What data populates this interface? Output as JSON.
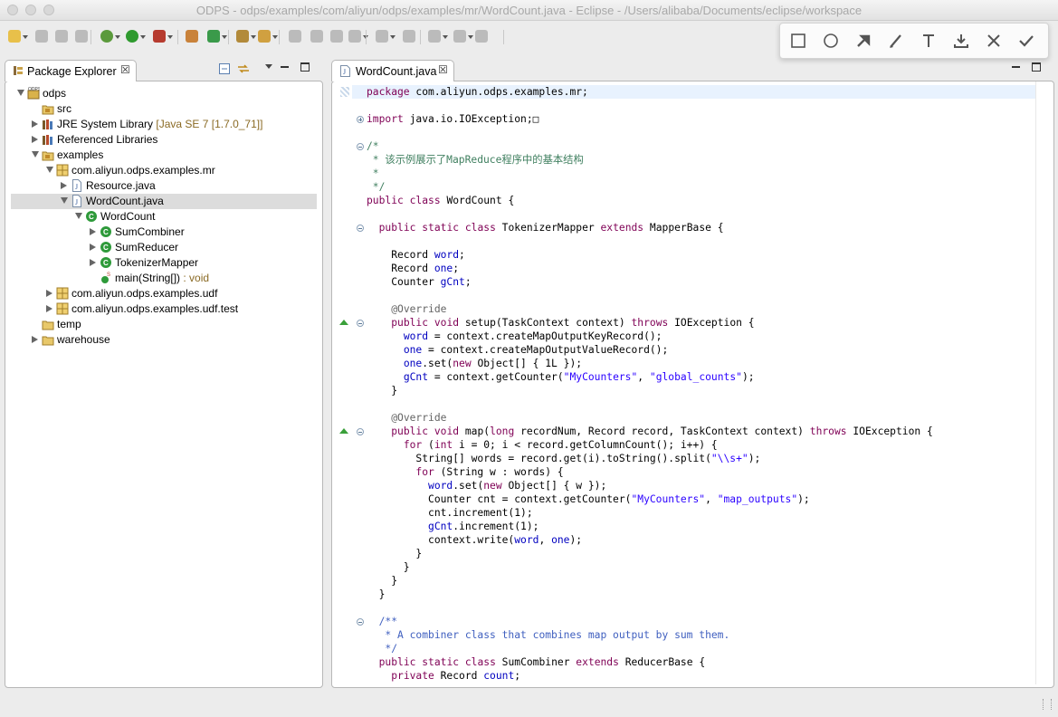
{
  "window": {
    "title": "ODPS - odps/examples/com/aliyun/odps/examples/mr/WordCount.java - Eclipse - /Users/alibaba/Documents/eclipse/workspace"
  },
  "toolbar": {
    "buttons": [
      "new-icon",
      "save-icon",
      "save-all-icon",
      "print-icon",
      "debug-icon",
      "run-icon",
      "run-external-icon",
      "new-java-package-icon",
      "new-java-class-icon",
      "open-type-icon",
      "search-icon",
      "toggle-mark-icon",
      "annotation-icon",
      "breadcrumb-icon",
      "block-icon",
      "next-annotation-icon",
      "prev-annotation-icon",
      "back-icon",
      "forward-icon",
      "pin-editor-icon"
    ]
  },
  "annotation_tools": [
    "rectangle-icon",
    "ellipse-icon",
    "arrow-icon",
    "pen-icon",
    "text-icon",
    "download-icon",
    "close-icon",
    "done-icon"
  ],
  "package_explorer": {
    "tab_label": "Package Explorer",
    "close_glyph": "☒",
    "tree": [
      {
        "label": "odps",
        "icon": "project-icon",
        "level": 0,
        "twisty": "open"
      },
      {
        "label": "src",
        "icon": "source-folder-icon",
        "level": 1,
        "twisty": "none"
      },
      {
        "label": "JRE System Library",
        "decoration": "[Java SE 7 [1.7.0_71]]",
        "icon": "library-icon",
        "level": 1,
        "twisty": "closed"
      },
      {
        "label": "Referenced Libraries",
        "icon": "library-icon",
        "level": 1,
        "twisty": "closed"
      },
      {
        "label": "examples",
        "icon": "source-folder-icon",
        "level": 1,
        "twisty": "open"
      },
      {
        "label": "com.aliyun.odps.examples.mr",
        "icon": "package-icon",
        "level": 2,
        "twisty": "open"
      },
      {
        "label": "Resource.java",
        "icon": "java-file-icon",
        "level": 3,
        "twisty": "closed"
      },
      {
        "label": "WordCount.java",
        "icon": "java-file-icon",
        "level": 3,
        "twisty": "open",
        "selected": true
      },
      {
        "label": "WordCount",
        "icon": "class-icon",
        "level": 4,
        "twisty": "open"
      },
      {
        "label": "SumCombiner",
        "icon": "class-icon",
        "level": 5,
        "twisty": "closed"
      },
      {
        "label": "SumReducer",
        "icon": "class-icon",
        "level": 5,
        "twisty": "closed"
      },
      {
        "label": "TokenizerMapper",
        "icon": "class-icon",
        "level": 5,
        "twisty": "closed"
      },
      {
        "label": "main(String[])",
        "decoration": " : void",
        "icon": "method-icon",
        "level": 5,
        "twisty": "none"
      },
      {
        "label": "com.aliyun.odps.examples.udf",
        "icon": "package-icon",
        "level": 2,
        "twisty": "closed"
      },
      {
        "label": "com.aliyun.odps.examples.udf.test",
        "icon": "package-icon",
        "level": 2,
        "twisty": "closed"
      },
      {
        "label": "temp",
        "icon": "folder-icon",
        "level": 1,
        "twisty": "none"
      },
      {
        "label": "warehouse",
        "icon": "folder-icon",
        "level": 1,
        "twisty": "closed"
      }
    ]
  },
  "editor": {
    "tab_label": "WordCount.java",
    "close_glyph": "☒",
    "lines": [
      [
        [
          "kw",
          "package"
        ],
        [
          "p",
          " com.aliyun.odps.examples.mr;"
        ]
      ],
      [],
      [
        [
          "kw",
          "import"
        ],
        [
          "p",
          " java.io.IOException;"
        ],
        [
          "p",
          "□"
        ]
      ],
      [],
      [
        [
          "cm",
          "/*"
        ]
      ],
      [
        [
          "cm",
          " * 该示例展示了MapReduce程序中的基本结构"
        ]
      ],
      [
        [
          "cm",
          " *"
        ]
      ],
      [
        [
          "cm",
          " */"
        ]
      ],
      [
        [
          "kw",
          "public"
        ],
        [
          "p",
          " "
        ],
        [
          "kw",
          "class"
        ],
        [
          "p",
          " WordCount {"
        ]
      ],
      [],
      [
        [
          "p",
          "  "
        ],
        [
          "kw",
          "public"
        ],
        [
          "p",
          " "
        ],
        [
          "kw",
          "static"
        ],
        [
          "p",
          " "
        ],
        [
          "kw",
          "class"
        ],
        [
          "p",
          " TokenizerMapper "
        ],
        [
          "kw",
          "extends"
        ],
        [
          "p",
          " MapperBase {"
        ]
      ],
      [],
      [
        [
          "p",
          "    Record "
        ],
        [
          "fld",
          "word"
        ],
        [
          "p",
          ";"
        ]
      ],
      [
        [
          "p",
          "    Record "
        ],
        [
          "fld",
          "one"
        ],
        [
          "p",
          ";"
        ]
      ],
      [
        [
          "p",
          "    Counter "
        ],
        [
          "fld",
          "gCnt"
        ],
        [
          "p",
          ";"
        ]
      ],
      [],
      [
        [
          "p",
          "    "
        ],
        [
          "ann",
          "@Override"
        ]
      ],
      [
        [
          "p",
          "    "
        ],
        [
          "kw",
          "public"
        ],
        [
          "p",
          " "
        ],
        [
          "kw",
          "void"
        ],
        [
          "p",
          " setup(TaskContext context) "
        ],
        [
          "kw",
          "throws"
        ],
        [
          "p",
          " IOException {"
        ]
      ],
      [
        [
          "p",
          "      "
        ],
        [
          "fld",
          "word"
        ],
        [
          "p",
          " = context.createMapOutputKeyRecord();"
        ]
      ],
      [
        [
          "p",
          "      "
        ],
        [
          "fld",
          "one"
        ],
        [
          "p",
          " = context.createMapOutputValueRecord();"
        ]
      ],
      [
        [
          "p",
          "      "
        ],
        [
          "fld",
          "one"
        ],
        [
          "p",
          ".set("
        ],
        [
          "kw",
          "new"
        ],
        [
          "p",
          " Object[] { 1L });"
        ]
      ],
      [
        [
          "p",
          "      "
        ],
        [
          "fld",
          "gCnt"
        ],
        [
          "p",
          " = context.getCounter("
        ],
        [
          "str",
          "\"MyCounters\""
        ],
        [
          "p",
          ", "
        ],
        [
          "str",
          "\"global_counts\""
        ],
        [
          "p",
          ");"
        ]
      ],
      [
        [
          "p",
          "    }"
        ]
      ],
      [],
      [
        [
          "p",
          "    "
        ],
        [
          "ann",
          "@Override"
        ]
      ],
      [
        [
          "p",
          "    "
        ],
        [
          "kw",
          "public"
        ],
        [
          "p",
          " "
        ],
        [
          "kw",
          "void"
        ],
        [
          "p",
          " map("
        ],
        [
          "kw",
          "long"
        ],
        [
          "p",
          " recordNum, Record record, TaskContext context) "
        ],
        [
          "kw",
          "throws"
        ],
        [
          "p",
          " IOException {"
        ]
      ],
      [
        [
          "p",
          "      "
        ],
        [
          "kw",
          "for"
        ],
        [
          "p",
          " ("
        ],
        [
          "kw",
          "int"
        ],
        [
          "p",
          " i = 0; i < record.getColumnCount(); i++) {"
        ]
      ],
      [
        [
          "p",
          "        String[] words = record.get(i).toString().split("
        ],
        [
          "str",
          "\"\\\\s+\""
        ],
        [
          "p",
          ");"
        ]
      ],
      [
        [
          "p",
          "        "
        ],
        [
          "kw",
          "for"
        ],
        [
          "p",
          " (String w : words) {"
        ]
      ],
      [
        [
          "p",
          "          "
        ],
        [
          "fld",
          "word"
        ],
        [
          "p",
          ".set("
        ],
        [
          "kw",
          "new"
        ],
        [
          "p",
          " Object[] { w });"
        ]
      ],
      [
        [
          "p",
          "          Counter cnt = context.getCounter("
        ],
        [
          "str",
          "\"MyCounters\""
        ],
        [
          "p",
          ", "
        ],
        [
          "str",
          "\"map_outputs\""
        ],
        [
          "p",
          ");"
        ]
      ],
      [
        [
          "p",
          "          cnt.increment(1);"
        ]
      ],
      [
        [
          "p",
          "          "
        ],
        [
          "fld",
          "gCnt"
        ],
        [
          "p",
          ".increment(1);"
        ]
      ],
      [
        [
          "p",
          "          context.write("
        ],
        [
          "fld",
          "word"
        ],
        [
          "p",
          ", "
        ],
        [
          "fld",
          "one"
        ],
        [
          "p",
          ");"
        ]
      ],
      [
        [
          "p",
          "        }"
        ]
      ],
      [
        [
          "p",
          "      }"
        ]
      ],
      [
        [
          "p",
          "    }"
        ]
      ],
      [
        [
          "p",
          "  }"
        ]
      ],
      [],
      [
        [
          "p",
          "  "
        ],
        [
          "jd",
          "/**"
        ]
      ],
      [
        [
          "p",
          "  "
        ],
        [
          "jd",
          " * A combiner class that combines map output by sum them."
        ]
      ],
      [
        [
          "p",
          "  "
        ],
        [
          "jd",
          " */"
        ]
      ],
      [
        [
          "p",
          "  "
        ],
        [
          "kw",
          "public"
        ],
        [
          "p",
          " "
        ],
        [
          "kw",
          "static"
        ],
        [
          "p",
          " "
        ],
        [
          "kw",
          "class"
        ],
        [
          "p",
          " SumCombiner "
        ],
        [
          "kw",
          "extends"
        ],
        [
          "p",
          " ReducerBase {"
        ]
      ],
      [
        [
          "p",
          "    "
        ],
        [
          "kw",
          "private"
        ],
        [
          "p",
          " Record "
        ],
        [
          "fld",
          "count"
        ],
        [
          "p",
          ";"
        ]
      ]
    ]
  },
  "colors": {
    "keyword": "#7f0055",
    "string": "#2a00ff",
    "comment": "#3f7f5f",
    "javadoc": "#3f5fbf",
    "field": "#0000c0",
    "selection": "#dcdcdc"
  }
}
